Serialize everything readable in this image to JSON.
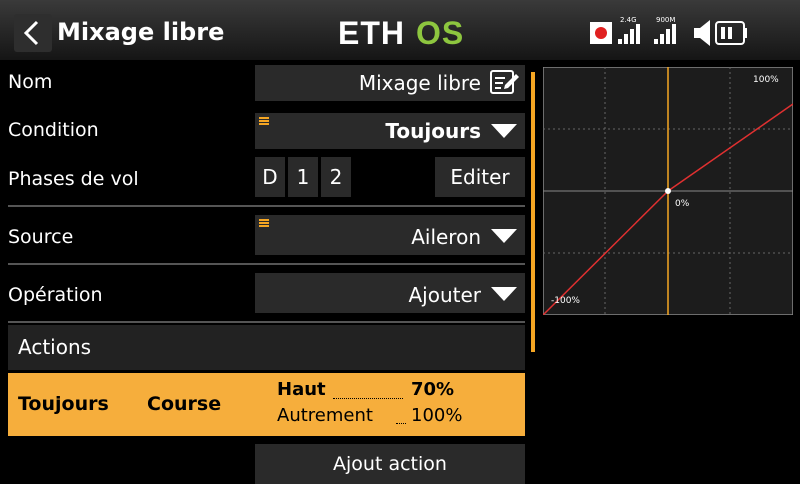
{
  "header": {
    "title": "Mixage libre",
    "logo": "ETHOS",
    "logo_colors": {
      "eth": "#ffffff",
      "os": "#8dc63f"
    },
    "status": {
      "record_color": "#e02020",
      "rx1_label": "2.4G",
      "rx2_label": "900M",
      "icons": [
        "record-icon",
        "signal-2-4g-icon",
        "signal-900m-icon",
        "speaker-icon",
        "battery-icon"
      ]
    }
  },
  "form": {
    "name": {
      "label": "Nom",
      "value": "Mixage libre",
      "icon": "edit-icon"
    },
    "condition": {
      "label": "Condition",
      "value": "Toujours"
    },
    "phases": {
      "label": "Phases de vol",
      "items": [
        "D",
        "1",
        "2"
      ],
      "edit_label": "Editer"
    },
    "source": {
      "label": "Source",
      "value": "Aileron"
    },
    "operation": {
      "label": "Opération",
      "value": "Ajouter"
    }
  },
  "actions": {
    "header": "Actions",
    "row": {
      "condition": "Toujours",
      "type": "Course",
      "key1": "Haut",
      "val1": "70%",
      "key2": "Autrement",
      "val2": "100%"
    },
    "add_label": "Ajout action"
  },
  "graph": {
    "max_label": "100%",
    "mid_label": "0%",
    "min_label": "-100%",
    "curve_color": "#e03030",
    "axis_color": "#f5a623"
  },
  "colors": {
    "accent": "#f6ae3c"
  }
}
